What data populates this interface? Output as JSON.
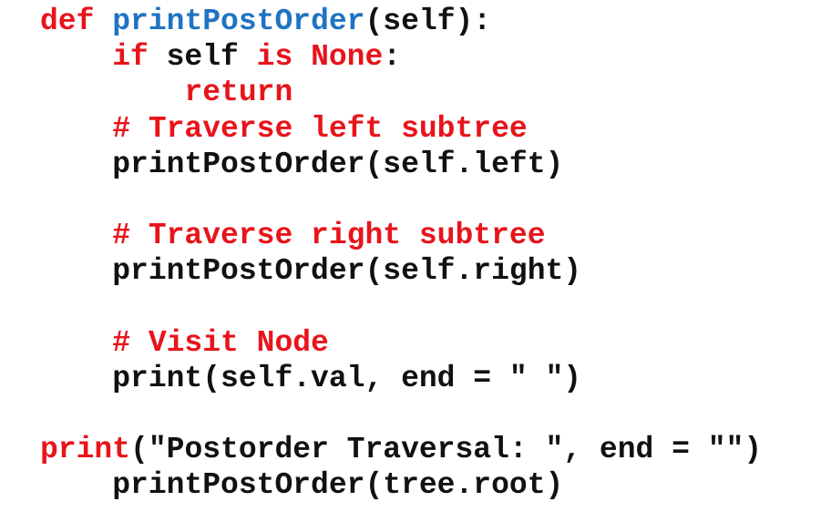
{
  "colors": {
    "keyword": "#e8141b",
    "function_name": "#1f73c2",
    "comment": "#e8141b",
    "text": "#111111",
    "background": "#ffffff"
  },
  "code": {
    "lines": [
      {
        "indent": "",
        "tokens": [
          {
            "t": "kw",
            "text": "def"
          },
          {
            "t": "tx",
            "text": " "
          },
          {
            "t": "fn",
            "text": "printPostOrder"
          },
          {
            "t": "tx",
            "text": "(self):"
          }
        ]
      },
      {
        "indent": "    ",
        "tokens": [
          {
            "t": "kw",
            "text": "if"
          },
          {
            "t": "tx",
            "text": " self "
          },
          {
            "t": "kw",
            "text": "is"
          },
          {
            "t": "tx",
            "text": " "
          },
          {
            "t": "kw",
            "text": "None"
          },
          {
            "t": "tx",
            "text": ":"
          }
        ]
      },
      {
        "indent": "        ",
        "tokens": [
          {
            "t": "kw",
            "text": "return"
          }
        ]
      },
      {
        "indent": "    ",
        "tokens": [
          {
            "t": "cm",
            "text": "# Traverse left subtree"
          }
        ]
      },
      {
        "indent": "    ",
        "tokens": [
          {
            "t": "tx",
            "text": "printPostOrder(self.left)"
          }
        ]
      },
      {
        "indent": "",
        "tokens": []
      },
      {
        "indent": "    ",
        "tokens": [
          {
            "t": "cm",
            "text": "# Traverse right subtree"
          }
        ]
      },
      {
        "indent": "    ",
        "tokens": [
          {
            "t": "tx",
            "text": "printPostOrder(self.right)"
          }
        ]
      },
      {
        "indent": "",
        "tokens": []
      },
      {
        "indent": "    ",
        "tokens": [
          {
            "t": "cm",
            "text": "# Visit Node"
          }
        ]
      },
      {
        "indent": "    ",
        "tokens": [
          {
            "t": "tx",
            "text": "print(self.val, end = \" \")"
          }
        ]
      },
      {
        "indent": "",
        "tokens": []
      },
      {
        "indent": "",
        "tokens": [
          {
            "t": "kw",
            "text": "print"
          },
          {
            "t": "tx",
            "text": "(\"Postorder Traversal: \", end = \"\")"
          }
        ]
      },
      {
        "indent": "    ",
        "tokens": [
          {
            "t": "tx",
            "text": "printPostOrder(tree.root)"
          }
        ]
      }
    ]
  }
}
